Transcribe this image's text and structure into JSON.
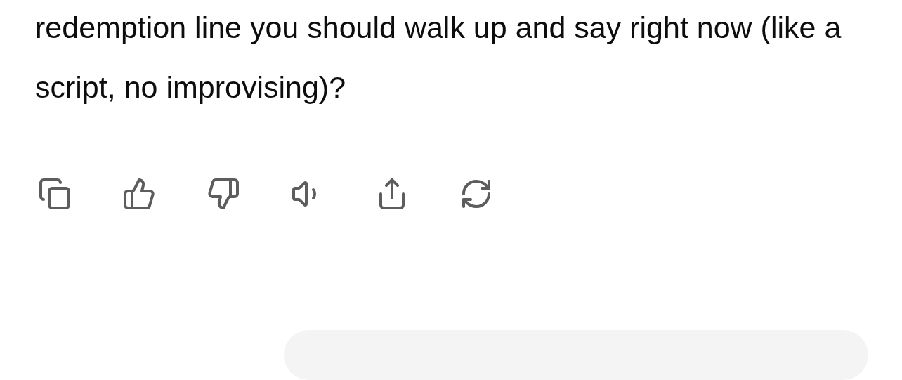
{
  "message": {
    "text": "redemption line you should walk up and say right now (like a script, no improvising)?"
  },
  "actions": [
    {
      "kind": "copy"
    },
    {
      "kind": "like"
    },
    {
      "kind": "dislike"
    },
    {
      "kind": "read-aloud"
    },
    {
      "kind": "share"
    },
    {
      "kind": "regenerate"
    }
  ]
}
